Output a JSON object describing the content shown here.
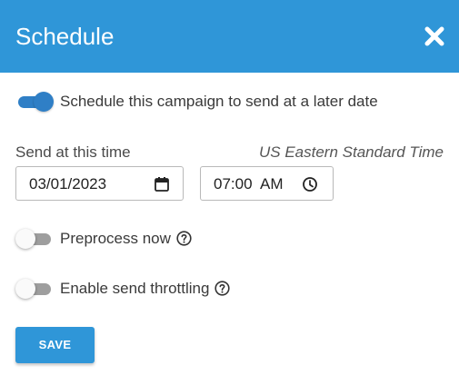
{
  "dialog": {
    "title": "Schedule",
    "close_icon": "close-icon"
  },
  "schedule_toggle": {
    "label": "Schedule this campaign to send at a later date",
    "checked": true
  },
  "send_time": {
    "label": "Send at this time",
    "timezone": "US Eastern Standard Time",
    "date_value": "03/01/2023",
    "date_icon": "calendar-icon",
    "time_value": "07:00  AM",
    "time_icon": "clock-icon"
  },
  "preprocess_toggle": {
    "label": "Preprocess now",
    "checked": false,
    "help_icon": "help-icon"
  },
  "throttle_toggle": {
    "label": "Enable send throttling",
    "checked": false,
    "help_icon": "help-icon"
  },
  "actions": {
    "save_label": "SAVE"
  },
  "colors": {
    "header": "#2f96d8",
    "toggle_on": "#2f7fc6",
    "toggle_off": "#9e9e9e",
    "button": "#2f96d8"
  }
}
